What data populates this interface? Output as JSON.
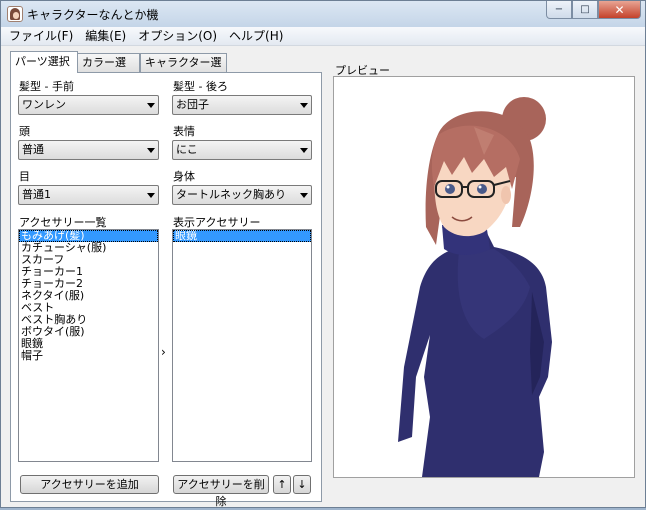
{
  "window": {
    "title": "キャラクターなんとか機",
    "minimize_glyph": "−",
    "restore_glyph": "□",
    "close_glyph": "✕"
  },
  "menu": [
    "ファイル(F)",
    "編集(E)",
    "オプション(O)",
    "ヘルプ(H)"
  ],
  "tabs": [
    "パーツ選択",
    "カラー選択",
    "キャラクター選択"
  ],
  "fields": {
    "hair_front": {
      "label": "髪型 - 手前",
      "value": "ワンレン"
    },
    "hair_back": {
      "label": "髪型 - 後ろ",
      "value": "お団子"
    },
    "head": {
      "label": "頭",
      "value": "普通"
    },
    "expression": {
      "label": "表情",
      "value": "にこ"
    },
    "eyes": {
      "label": "目",
      "value": "普通1"
    },
    "body": {
      "label": "身体",
      "value": "タートルネック胸あり"
    }
  },
  "accessory_list": {
    "label": "アクセサリー一覧",
    "items": [
      "もみあげ(髪)",
      "カチューシャ(服)",
      "スカーフ",
      "チョーカー1",
      "チョーカー2",
      "ネクタイ(服)",
      "ベスト",
      "ベスト胸あり",
      "ボウタイ(服)",
      "眼鏡",
      "帽子"
    ],
    "selected_index": 0
  },
  "shown_accessories": {
    "label": "表示アクセサリー",
    "items": [
      "眼鏡"
    ],
    "selected_index": 0
  },
  "move_arrow": "›",
  "buttons": {
    "add": "アクセサリーを追加",
    "remove": "アクセサリーを削除",
    "up": "↑",
    "down": "↓"
  },
  "preview": {
    "label": "プレビュー"
  },
  "colors": {
    "selection": "#3399ff",
    "hair": "#a8645a",
    "sweater": "#2f2f6e",
    "skin": "#f8d7c2"
  }
}
